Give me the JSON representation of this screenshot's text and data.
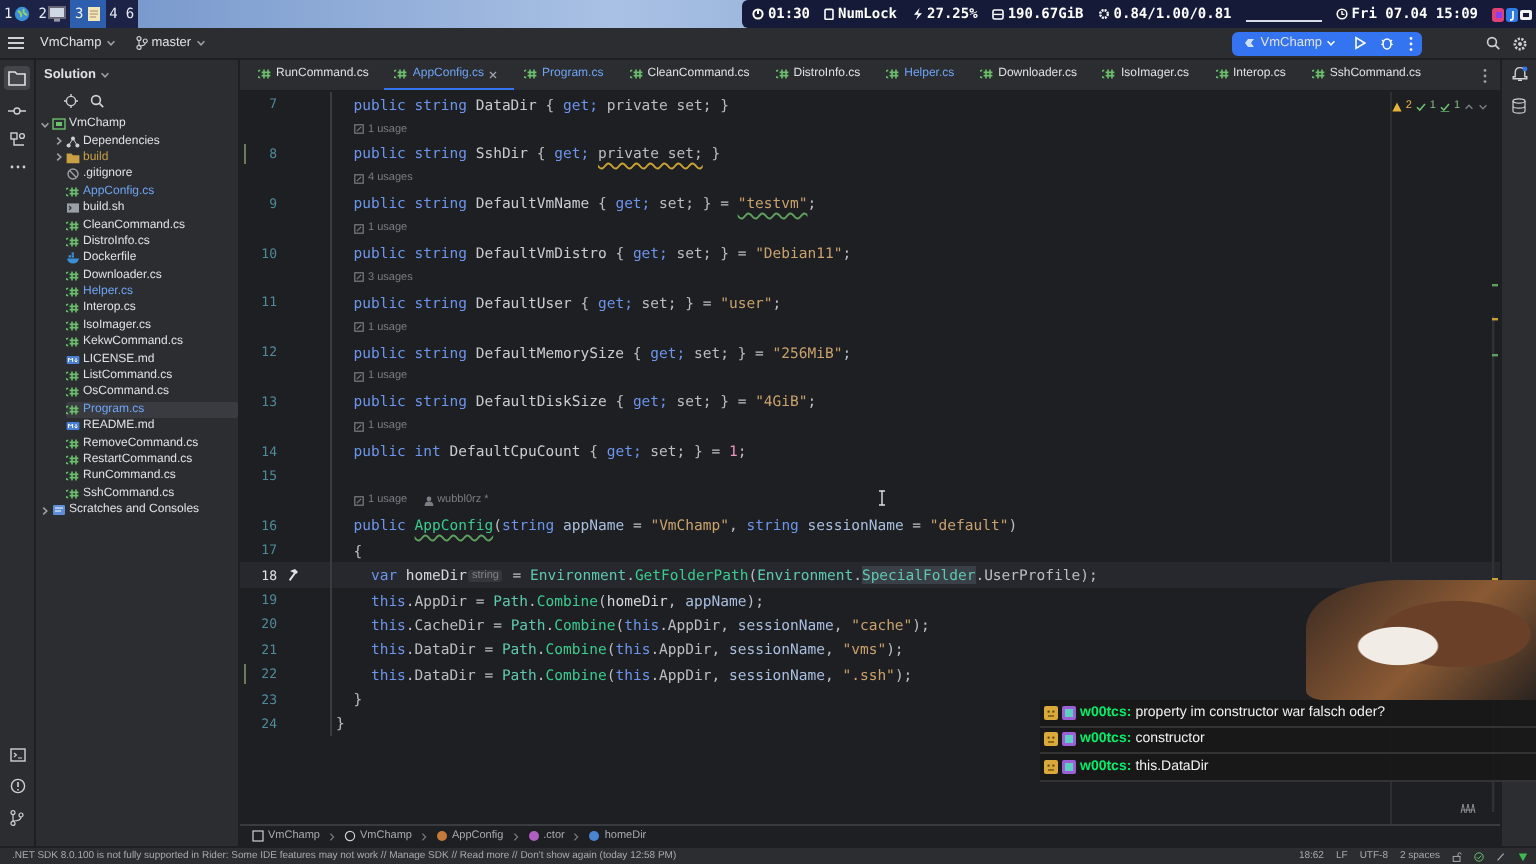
{
  "desktop_bar": {
    "workspaces": [
      {
        "label": "1",
        "kind": "browser",
        "selected": false
      },
      {
        "label": "2",
        "kind": "monitor",
        "selected": false
      },
      {
        "label": "3",
        "kind": "notes",
        "selected": true
      },
      {
        "label": "4",
        "kind": "none",
        "selected": false
      },
      {
        "label": "6",
        "kind": "none",
        "selected": false
      }
    ],
    "indicators": [
      {
        "kind": "uptime",
        "text": "01:30"
      },
      {
        "kind": "keyboard",
        "text": "NumLock"
      },
      {
        "kind": "cpu",
        "text": "27.25%"
      },
      {
        "kind": "disk",
        "text": "190.67GiB"
      },
      {
        "kind": "load",
        "text": "0.84/1.00/0.81"
      },
      {
        "kind": "blank"
      },
      {
        "kind": "clock",
        "text": "Fri 07.04 15:09"
      }
    ]
  },
  "ide": {
    "project": "VmChamp",
    "branch": "master",
    "run_config": "VmChamp",
    "sidebar": {
      "title": "Solution",
      "tree": [
        {
          "label": "VmChamp",
          "kind": "project",
          "modified": false,
          "ignored": false,
          "selected": false,
          "expanded": true,
          "children": [
            {
              "label": "Dependencies",
              "kind": "deps",
              "modified": false,
              "ignored": false,
              "selected": false,
              "expanded": false
            },
            {
              "label": "build",
              "kind": "folder",
              "modified": false,
              "ignored": true,
              "selected": false,
              "expanded": false
            },
            {
              "label": ".gitignore",
              "kind": "ignore",
              "modified": false,
              "ignored": false,
              "selected": false
            },
            {
              "label": "AppConfig.cs",
              "kind": "cs",
              "modified": true,
              "ignored": false,
              "selected": false
            },
            {
              "label": "build.sh",
              "kind": "shell",
              "modified": false,
              "ignored": false,
              "selected": false
            },
            {
              "label": "CleanCommand.cs",
              "kind": "cs",
              "modified": false,
              "ignored": false,
              "selected": false
            },
            {
              "label": "DistroInfo.cs",
              "kind": "cs",
              "modified": false,
              "ignored": false,
              "selected": false
            },
            {
              "label": "Dockerfile",
              "kind": "docker",
              "modified": false,
              "ignored": false,
              "selected": false
            },
            {
              "label": "Downloader.cs",
              "kind": "cs",
              "modified": false,
              "ignored": false,
              "selected": false
            },
            {
              "label": "Helper.cs",
              "kind": "cs",
              "modified": true,
              "ignored": false,
              "selected": false
            },
            {
              "label": "Interop.cs",
              "kind": "cs",
              "modified": false,
              "ignored": false,
              "selected": false
            },
            {
              "label": "IsoImager.cs",
              "kind": "cs",
              "modified": false,
              "ignored": false,
              "selected": false
            },
            {
              "label": "KekwCommand.cs",
              "kind": "cs",
              "modified": false,
              "ignored": false,
              "selected": false
            },
            {
              "label": "LICENSE.md",
              "kind": "md",
              "modified": false,
              "ignored": false,
              "selected": false
            },
            {
              "label": "ListCommand.cs",
              "kind": "cs",
              "modified": false,
              "ignored": false,
              "selected": false
            },
            {
              "label": "OsCommand.cs",
              "kind": "cs",
              "modified": false,
              "ignored": false,
              "selected": false
            },
            {
              "label": "Program.cs",
              "kind": "cs",
              "modified": true,
              "ignored": false,
              "selected": true
            },
            {
              "label": "README.md",
              "kind": "md",
              "modified": false,
              "ignored": false,
              "selected": false
            },
            {
              "label": "RemoveCommand.cs",
              "kind": "cs",
              "modified": false,
              "ignored": false,
              "selected": false
            },
            {
              "label": "RestartCommand.cs",
              "kind": "cs",
              "modified": false,
              "ignored": false,
              "selected": false
            },
            {
              "label": "RunCommand.cs",
              "kind": "cs",
              "modified": false,
              "ignored": false,
              "selected": false
            },
            {
              "label": "SshCommand.cs",
              "kind": "cs",
              "modified": false,
              "ignored": false,
              "selected": false
            }
          ]
        },
        {
          "label": "Scratches and Consoles",
          "kind": "scratches",
          "modified": false,
          "ignored": false,
          "selected": false,
          "expanded": false
        }
      ]
    },
    "tabs": [
      {
        "label": "RunCommand.cs",
        "modified": false,
        "selected": false
      },
      {
        "label": "AppConfig.cs",
        "modified": true,
        "selected": true
      },
      {
        "label": "Program.cs",
        "modified": true,
        "selected": false
      },
      {
        "label": "CleanCommand.cs",
        "modified": false,
        "selected": false
      },
      {
        "label": "DistroInfo.cs",
        "modified": false,
        "selected": false
      },
      {
        "label": "Helper.cs",
        "modified": true,
        "selected": false
      },
      {
        "label": "Downloader.cs",
        "modified": false,
        "selected": false
      },
      {
        "label": "IsoImager.cs",
        "modified": false,
        "selected": false
      },
      {
        "label": "Interop.cs",
        "modified": false,
        "selected": false
      },
      {
        "label": "SshCommand.cs",
        "modified": false,
        "selected": false
      }
    ],
    "editor": {
      "inspections": [
        {
          "kind": "warning",
          "count": "2"
        },
        {
          "kind": "weak",
          "count": "1"
        },
        {
          "kind": "typo",
          "count": "1"
        }
      ],
      "lines": [
        {
          "number": "7",
          "current": false,
          "changed": false,
          "tokens": [
            {
              "text": "  public string ",
              "kind": "kw"
            },
            {
              "text": "DataDir",
              "kind": "prop"
            },
            {
              "text": " { ",
              "kind": "p"
            },
            {
              "text": "get;",
              "kind": "kw"
            },
            {
              "text": " private set; }",
              "kind": "p"
            }
          ]
        },
        {
          "number": "8",
          "current": false,
          "changed": true,
          "hints": [
            {
              "kind": "usages",
              "text": "1 usage"
            }
          ],
          "tokens": [
            {
              "text": "  public string ",
              "kind": "kw"
            },
            {
              "text": "SshDir",
              "kind": "prop"
            },
            {
              "text": " { ",
              "kind": "p"
            },
            {
              "text": "get; ",
              "kind": "kw"
            },
            {
              "text": "private set;",
              "kind": "p_warning"
            },
            {
              "text": " }",
              "kind": "p"
            }
          ]
        },
        {
          "number": "9",
          "current": false,
          "changed": false,
          "hints": [
            {
              "kind": "usages",
              "text": "4 usages"
            }
          ],
          "tokens": [
            {
              "text": "  public string ",
              "kind": "kw"
            },
            {
              "text": "DefaultVmName",
              "kind": "prop"
            },
            {
              "text": " { ",
              "kind": "p"
            },
            {
              "text": "get;",
              "kind": "kw"
            },
            {
              "text": " set; } = ",
              "kind": "p"
            },
            {
              "text": "\"testvm\"",
              "kind": "str_typo"
            },
            {
              "text": ";",
              "kind": "p"
            }
          ]
        },
        {
          "number": "10",
          "current": false,
          "changed": false,
          "hints": [
            {
              "kind": "usages",
              "text": "1 usage"
            }
          ],
          "tokens": [
            {
              "text": "  public string ",
              "kind": "kw"
            },
            {
              "text": "DefaultVmDistro",
              "kind": "prop"
            },
            {
              "text": " { ",
              "kind": "p"
            },
            {
              "text": "get;",
              "kind": "kw"
            },
            {
              "text": " set; } = ",
              "kind": "p"
            },
            {
              "text": "\"Debian11\"",
              "kind": "str"
            },
            {
              "text": ";",
              "kind": "p"
            }
          ]
        },
        {
          "number": "11",
          "current": false,
          "changed": false,
          "hints": [
            {
              "kind": "usages",
              "text": "3 usages"
            }
          ],
          "tokens": [
            {
              "text": "  public string ",
              "kind": "kw"
            },
            {
              "text": "DefaultUser",
              "kind": "prop"
            },
            {
              "text": " { ",
              "kind": "p"
            },
            {
              "text": "get;",
              "kind": "kw"
            },
            {
              "text": " set; } = ",
              "kind": "p"
            },
            {
              "text": "\"user\"",
              "kind": "str"
            },
            {
              "text": ";",
              "kind": "p"
            }
          ]
        },
        {
          "number": "12",
          "current": false,
          "changed": false,
          "hints": [
            {
              "kind": "usages",
              "text": "1 usage"
            }
          ],
          "tokens": [
            {
              "text": "  public string ",
              "kind": "kw"
            },
            {
              "text": "DefaultMemorySize",
              "kind": "prop"
            },
            {
              "text": " { ",
              "kind": "p"
            },
            {
              "text": "get;",
              "kind": "kw"
            },
            {
              "text": " set; } = ",
              "kind": "p"
            },
            {
              "text": "\"256MiB\"",
              "kind": "str"
            },
            {
              "text": ";",
              "kind": "p"
            }
          ]
        },
        {
          "number": "13",
          "current": false,
          "changed": false,
          "hints": [
            {
              "kind": "usages",
              "text": "1 usage"
            }
          ],
          "tokens": [
            {
              "text": "  public string ",
              "kind": "kw"
            },
            {
              "text": "DefaultDiskSize",
              "kind": "prop"
            },
            {
              "text": " { ",
              "kind": "p"
            },
            {
              "text": "get;",
              "kind": "kw"
            },
            {
              "text": " set; } = ",
              "kind": "p"
            },
            {
              "text": "\"4GiB\"",
              "kind": "str"
            },
            {
              "text": ";",
              "kind": "p"
            }
          ]
        },
        {
          "number": "14",
          "current": false,
          "changed": false,
          "hints": [
            {
              "kind": "usages",
              "text": "1 usage"
            }
          ],
          "tokens": [
            {
              "text": "  public int ",
              "kind": "kw"
            },
            {
              "text": "DefaultCpuCount",
              "kind": "prop"
            },
            {
              "text": " { ",
              "kind": "p"
            },
            {
              "text": "get;",
              "kind": "kw"
            },
            {
              "text": " set; } = ",
              "kind": "p"
            },
            {
              "text": "1",
              "kind": "num"
            },
            {
              "text": ";",
              "kind": "p"
            }
          ]
        },
        {
          "number": "15",
          "current": false,
          "changed": false
        },
        {
          "number": "16",
          "current": false,
          "changed": false,
          "hints": [
            {
              "kind": "usages",
              "text": "1 usage"
            },
            {
              "kind": "author",
              "text": "wubbl0rz *"
            }
          ],
          "tokens": [
            {
              "text": "  public ",
              "kind": "kw"
            },
            {
              "text": "AppConfig",
              "kind": "method_typo"
            },
            {
              "text": "(",
              "kind": "p"
            },
            {
              "text": "string ",
              "kind": "kw"
            },
            {
              "text": "appName",
              "kind": "param"
            },
            {
              "text": " = ",
              "kind": "p"
            },
            {
              "text": "\"VmChamp\"",
              "kind": "str"
            },
            {
              "text": ", ",
              "kind": "p"
            },
            {
              "text": "string ",
              "kind": "kw"
            },
            {
              "text": "sessionName",
              "kind": "param"
            },
            {
              "text": " = ",
              "kind": "p"
            },
            {
              "text": "\"default\"",
              "kind": "str"
            },
            {
              "text": ")",
              "kind": "p"
            }
          ]
        },
        {
          "number": "17",
          "current": false,
          "changed": false,
          "tokens": [
            {
              "text": "  {",
              "kind": "p"
            }
          ]
        },
        {
          "number": "18",
          "current": true,
          "changed": false,
          "tokens": [
            {
              "text": "    var ",
              "kind": "kw"
            },
            {
              "text": "homeDir",
              "kind": "local"
            },
            {
              "text": "string",
              "kind": "inlay"
            },
            {
              "text": " = ",
              "kind": "p"
            },
            {
              "text": "Environment",
              "kind": "cls"
            },
            {
              "text": ".",
              "kind": "p"
            },
            {
              "text": "GetFolderPath",
              "kind": "method"
            },
            {
              "text": "(",
              "kind": "p"
            },
            {
              "text": "Environment",
              "kind": "cls"
            },
            {
              "text": ".",
              "kind": "p"
            },
            {
              "text": "SpecialFolder",
              "kind": "cls_match"
            },
            {
              "text": ".UserProfile);",
              "kind": "p"
            }
          ]
        },
        {
          "number": "19",
          "current": false,
          "changed": false,
          "tokens": [
            {
              "text": "    this",
              "kind": "kw"
            },
            {
              "text": ".AppDir = ",
              "kind": "p"
            },
            {
              "text": "Path",
              "kind": "cls"
            },
            {
              "text": ".",
              "kind": "p"
            },
            {
              "text": "Combine",
              "kind": "method"
            },
            {
              "text": "(",
              "kind": "p"
            },
            {
              "text": "homeDir",
              "kind": "local"
            },
            {
              "text": ", ",
              "kind": "p"
            },
            {
              "text": "appName",
              "kind": "param"
            },
            {
              "text": ");",
              "kind": "p"
            }
          ]
        },
        {
          "number": "20",
          "current": false,
          "changed": false,
          "tokens": [
            {
              "text": "    this",
              "kind": "kw"
            },
            {
              "text": ".CacheDir = ",
              "kind": "p"
            },
            {
              "text": "Path",
              "kind": "cls"
            },
            {
              "text": ".",
              "kind": "p"
            },
            {
              "text": "Combine",
              "kind": "method"
            },
            {
              "text": "(",
              "kind": "p"
            },
            {
              "text": "this",
              "kind": "kw"
            },
            {
              "text": ".AppDir, ",
              "kind": "p"
            },
            {
              "text": "sessionName",
              "kind": "param"
            },
            {
              "text": ", ",
              "kind": "p"
            },
            {
              "text": "\"cache\"",
              "kind": "str"
            },
            {
              "text": ");",
              "kind": "p"
            }
          ]
        },
        {
          "number": "21",
          "current": false,
          "changed": false,
          "tokens": [
            {
              "text": "    this",
              "kind": "kw"
            },
            {
              "text": ".DataDir = ",
              "kind": "p"
            },
            {
              "text": "Path",
              "kind": "cls"
            },
            {
              "text": ".",
              "kind": "p"
            },
            {
              "text": "Combine",
              "kind": "method"
            },
            {
              "text": "(",
              "kind": "p"
            },
            {
              "text": "this",
              "kind": "kw"
            },
            {
              "text": ".AppDir, ",
              "kind": "p"
            },
            {
              "text": "sessionName",
              "kind": "param"
            },
            {
              "text": ", ",
              "kind": "p"
            },
            {
              "text": "\"vms\"",
              "kind": "str"
            },
            {
              "text": ");",
              "kind": "p"
            }
          ]
        },
        {
          "number": "22",
          "current": false,
          "changed": true,
          "tokens": [
            {
              "text": "    this",
              "kind": "kw"
            },
            {
              "text": ".DataDir = ",
              "kind": "p"
            },
            {
              "text": "Path",
              "kind": "cls"
            },
            {
              "text": ".",
              "kind": "p"
            },
            {
              "text": "Combine",
              "kind": "method"
            },
            {
              "text": "(",
              "kind": "p"
            },
            {
              "text": "this",
              "kind": "kw"
            },
            {
              "text": ".AppDir, ",
              "kind": "p"
            },
            {
              "text": "sessionName",
              "kind": "param"
            },
            {
              "text": ", ",
              "kind": "p"
            },
            {
              "text": "\".ssh\"",
              "kind": "str"
            },
            {
              "text": ");",
              "kind": "p"
            }
          ]
        },
        {
          "number": "23",
          "current": false,
          "changed": false,
          "tokens": [
            {
              "text": "  }",
              "kind": "p"
            }
          ]
        },
        {
          "number": "24",
          "current": false,
          "changed": false,
          "tokens": [
            {
              "text": "}",
              "kind": "p"
            }
          ]
        }
      ]
    },
    "breadcrumbs": [
      {
        "kind": "project",
        "text": "VmChamp"
      },
      {
        "kind": "namespace",
        "text": "VmChamp"
      },
      {
        "kind": "class",
        "text": "AppConfig"
      },
      {
        "kind": "method",
        "text": ".ctor"
      },
      {
        "kind": "field",
        "text": "homeDir"
      }
    ],
    "status": {
      "message": ".NET SDK 8.0.100 is not fully supported in Rider: Some IDE features may not work // Manage SDK // Read more // Don't show again (today 12:58 PM)",
      "items": [
        "18:62",
        "LF",
        "UTF-8",
        "2 spaces"
      ]
    }
  },
  "chat": [
    {
      "user": "w00tcs:",
      "text": "property im constructor war falsch oder?"
    },
    {
      "user": "w00tcs:",
      "text": "constructor"
    },
    {
      "user": "w00tcs:",
      "text": "this.DataDir"
    }
  ]
}
